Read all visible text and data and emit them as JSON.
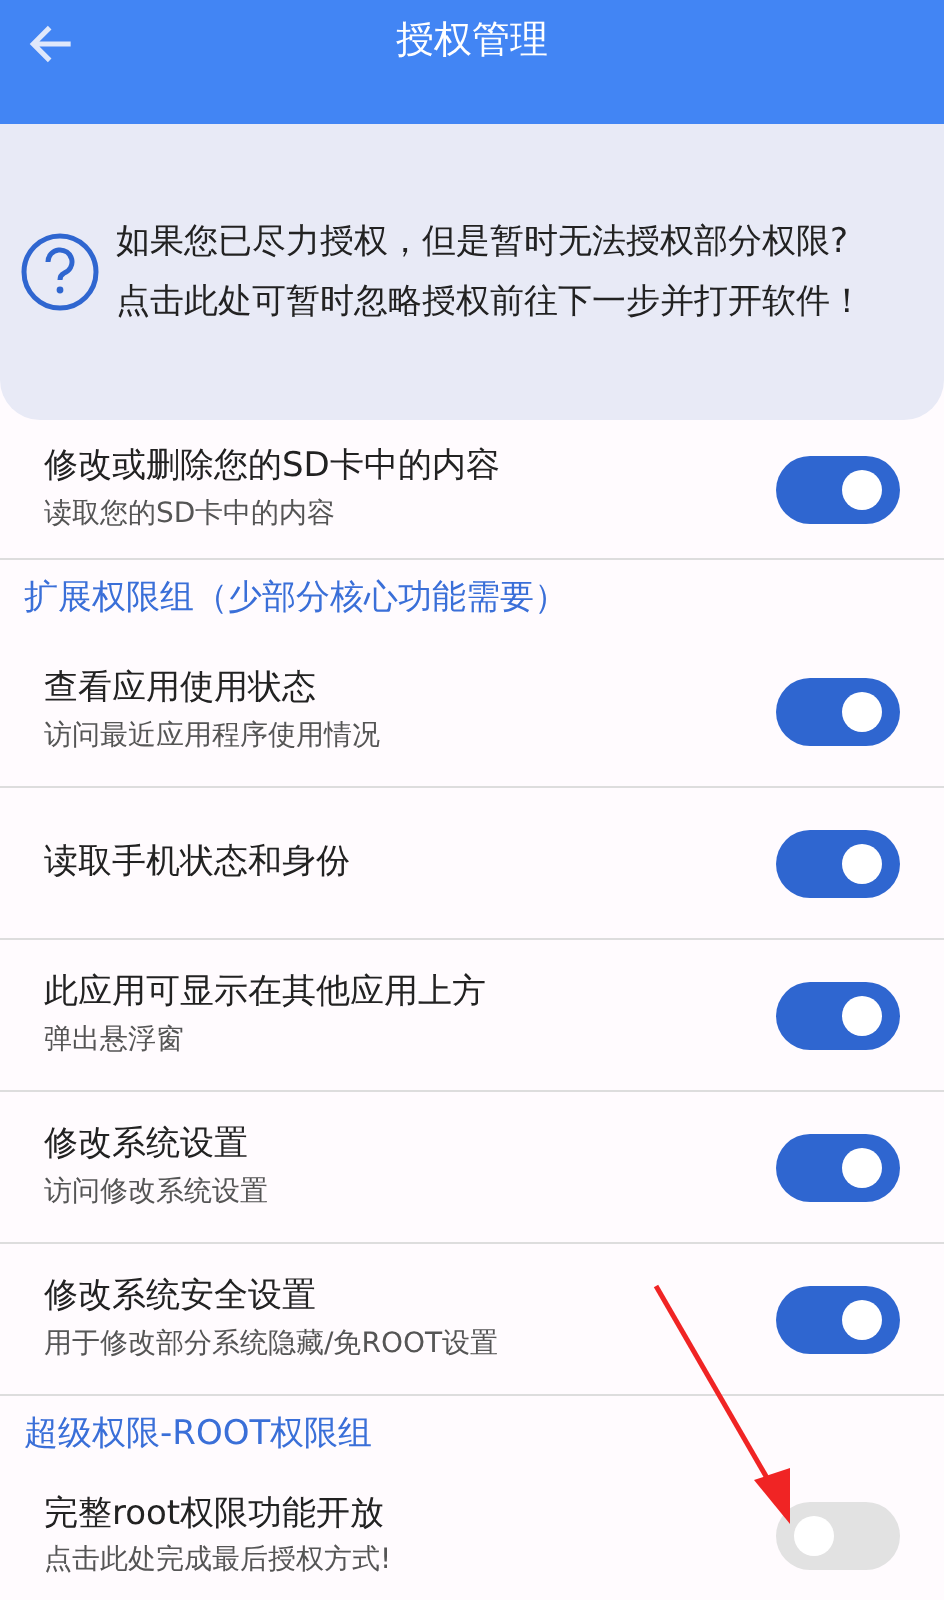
{
  "app_bar": {
    "title": "授权管理"
  },
  "notice": {
    "text": "如果您已尽力授权，但是暂时无法授权部分权限?\n点击此处可暂时忽略授权前往下一步并打开软件！"
  },
  "sections": [
    {
      "items": [
        {
          "title": "修改或删除您的SD卡中的内容",
          "subtitle": "读取您的SD卡中的内容",
          "on": true
        }
      ]
    },
    {
      "title": "扩展权限组（少部分核心功能需要）",
      "items": [
        {
          "title": "查看应用使用状态",
          "subtitle": "访问最近应用程序使用情况",
          "on": true
        },
        {
          "title": "读取手机状态和身份",
          "on": true
        },
        {
          "title": "此应用可显示在其他应用上方",
          "subtitle": "弹出悬浮窗",
          "on": true
        },
        {
          "title": "修改系统设置",
          "subtitle": "访问修改系统设置",
          "on": true
        },
        {
          "title": "修改系统安全设置",
          "subtitle": "用于修改部分系统隐藏/免ROOT设置",
          "on": true
        }
      ]
    },
    {
      "title": "超级权限-ROOT权限组",
      "items": [
        {
          "title": "完整root权限功能开放",
          "subtitle": "点击此处完成最后授权方式!",
          "on": false
        }
      ]
    }
  ]
}
